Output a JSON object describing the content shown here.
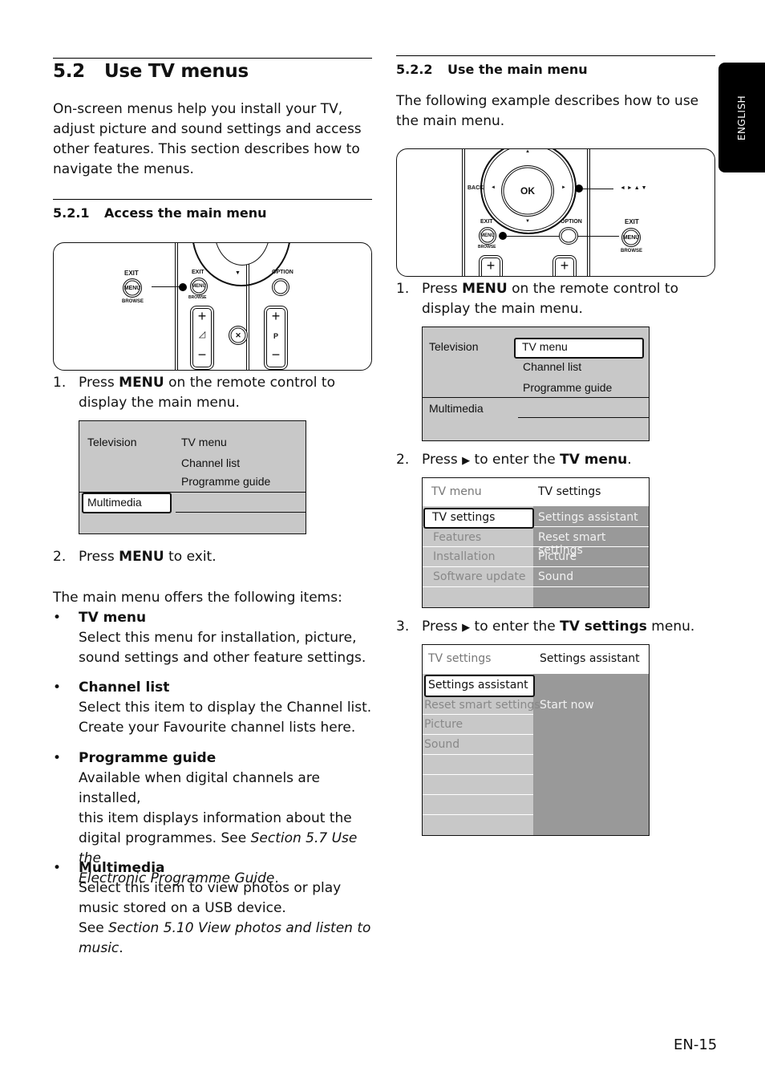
{
  "side_tab": {
    "language": "ENGLISH"
  },
  "left": {
    "section": {
      "number": "5.2",
      "title": "Use TV menus"
    },
    "intro": [
      "On-screen menus help you install your TV,",
      "adjust picture and sound settings and access",
      "other features. This section describes how to",
      "navigate the menus."
    ],
    "subsection": {
      "number": "5.2.1",
      "title": "Access the main menu"
    },
    "remote": {
      "callout_exit": "EXIT",
      "callout_menu": "MENU",
      "callout_browse": "BROWSE",
      "exit": "EXIT",
      "menu": "MENU",
      "browse": "BROWSE",
      "option": "OPTION",
      "down_arrow": "▼",
      "plus": "+",
      "minus": "−",
      "volume": "◿",
      "mute": "🔇",
      "program": "P"
    },
    "step1": {
      "num": "1.",
      "pre": "Press ",
      "key": "MENU",
      "post": " on the remote control to",
      "line2": "display the main menu."
    },
    "menu_screen": {
      "col1": [
        "Television",
        "Multimedia"
      ],
      "col2": [
        "TV menu",
        "Channel list",
        "Programme guide"
      ],
      "selected": "Multimedia"
    },
    "step2": {
      "num": "2.",
      "pre": "Press ",
      "key": "MENU",
      "post": " to exit."
    },
    "items_intro": "The main menu offers the following items:",
    "items": [
      {
        "bullet": "•",
        "title": "TV menu",
        "lines": [
          "Select this menu for installation, picture,",
          "sound settings and other feature settings."
        ]
      },
      {
        "bullet": "•",
        "title": "Channel list",
        "lines": [
          "Select this item to display the Channel list.",
          "Create your Favourite channel lists here."
        ]
      },
      {
        "bullet": "•",
        "title": "Programme guide",
        "lines": [
          "Available when digital channels are installed,",
          "this item displays information about the"
        ],
        "line3_pre": "digital programmes. See ",
        "line3_ref": "Section 5.7 Use the",
        "line4_ref": "Electronic Programme Guide",
        "line4_post": "."
      },
      {
        "bullet": "•",
        "title": "Multimedia",
        "lines": [
          "Select this item to view photos or play",
          "music stored on a USB device."
        ],
        "line3_pre": "See ",
        "line3_ref": "Section 5.10 View photos and listen to",
        "line4_ref": "music",
        "line4_post": "."
      }
    ]
  },
  "right": {
    "subsection": {
      "number": "5.2.2",
      "title": "Use the main menu"
    },
    "intro": [
      "The following example describes how to use",
      "the main menu."
    ],
    "remote": {
      "back": "BACK",
      "ok": "OK",
      "up": "▲",
      "down": "▼",
      "left": "◄",
      "right": "►",
      "nav_callout": "◄ ► ▲ ▼",
      "exit": "EXIT",
      "menu": "MENU",
      "browse": "BROWSE",
      "option": "OPTION",
      "callout_exit": "EXIT",
      "callout_menu": "MENU",
      "callout_browse": "BROWSE",
      "plus": "+"
    },
    "step1": {
      "num": "1.",
      "pre": "Press ",
      "key": "MENU",
      "post": " on the remote control to",
      "line2": "display the main menu."
    },
    "screen1": {
      "col1": [
        "Television",
        "Multimedia"
      ],
      "col2": [
        "TV menu",
        "Channel list",
        "Programme guide"
      ],
      "selected": "TV menu"
    },
    "step2": {
      "num": "2.",
      "pre": "Press ",
      "arrow": "▶",
      "mid": " to enter the ",
      "key": "TV menu",
      "post": "."
    },
    "screen2": {
      "header_left": "TV menu",
      "header_right": "TV settings",
      "left_items": [
        "TV settings",
        "Features",
        "Installation",
        "Software update"
      ],
      "right_items": [
        "Settings assistant",
        "Reset smart settings",
        "Picture",
        "Sound"
      ],
      "selected": "TV settings"
    },
    "step3": {
      "num": "3.",
      "pre": "Press ",
      "arrow": "▶",
      "mid": " to enter the ",
      "key": "TV settings",
      "post": " menu."
    },
    "screen3": {
      "header_left": "TV settings",
      "header_right": "Settings assistant",
      "left_items": [
        "Settings assistant",
        "Reset smart settings",
        "Picture",
        "Sound"
      ],
      "right_value": "Start now",
      "selected": "Settings assistant"
    }
  },
  "footer": {
    "page": "EN-15"
  }
}
